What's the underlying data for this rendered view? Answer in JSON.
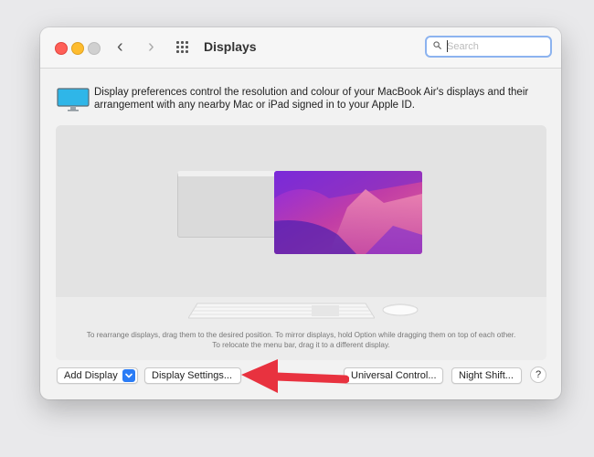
{
  "window": {
    "title": "Displays",
    "search": {
      "placeholder": "Search",
      "value": ""
    }
  },
  "info": {
    "text": "Display preferences control the resolution and colour of your MacBook Air's displays and their arrangement with any nearby Mac or iPad signed in to your Apple ID."
  },
  "arrangement": {
    "hint": "To rearrange displays, drag them to the desired position. To mirror displays, hold Option while dragging them on top of each other. To relocate the menu bar, drag it to a different display."
  },
  "buttons": {
    "add_display": "Add Display",
    "display_settings": "Display Settings...",
    "universal_control": "Universal Control...",
    "night_shift": "Night Shift...",
    "help": "?"
  },
  "icons": {
    "back": "chevron-left-icon",
    "forward": "chevron-right-icon",
    "grid": "grid-icon",
    "search": "search-icon",
    "display": "display-icon",
    "keyboard": "keyboard-icon",
    "mouse": "mouse-icon",
    "dropdown": "chevron-down-icon",
    "annotation": "red-arrow-icon"
  },
  "colors": {
    "accent": "#2a7cf6",
    "annotation_arrow": "#e8323f",
    "window_bg": "#f2f2f2"
  }
}
